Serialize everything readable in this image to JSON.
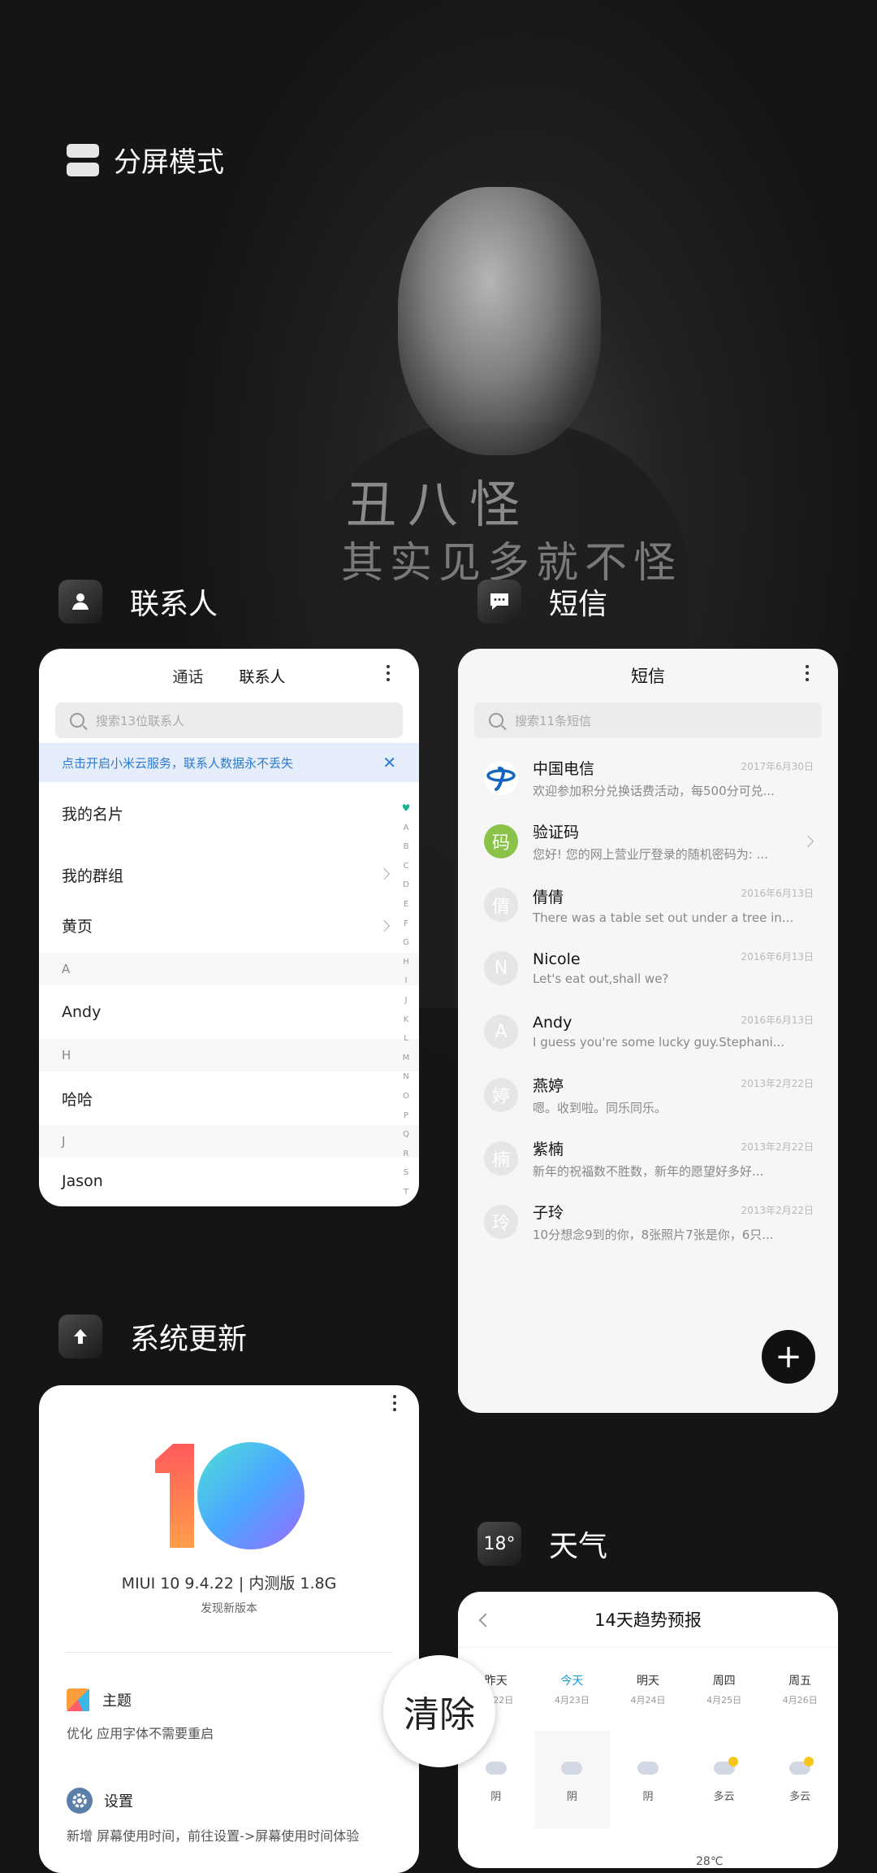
{
  "split_mode": {
    "label": "分屏模式"
  },
  "apps": {
    "contacts": {
      "name": "联系人",
      "tabs": [
        "通话",
        "联系人"
      ],
      "search_placeholder": "搜索13位联系人",
      "banner": "点击开启小米云服务，联系人数据永不丢失",
      "banner_close": "✕",
      "rows": {
        "my_card": "我的名片",
        "my_groups": "我的群组",
        "yellow_pages": "黄页"
      },
      "sections": [
        {
          "letter": "A",
          "contact": "Andy"
        },
        {
          "letter": "H",
          "contact": "哈哈"
        },
        {
          "letter": "J",
          "contact": "Jason"
        }
      ],
      "alphabet": [
        "A",
        "B",
        "C",
        "D",
        "E",
        "F",
        "G",
        "H",
        "I",
        "J",
        "K",
        "L",
        "M",
        "N",
        "O",
        "P",
        "Q",
        "R",
        "S",
        "T"
      ]
    },
    "sms": {
      "name": "短信",
      "title": "短信",
      "search_placeholder": "搜索11条短信",
      "messages": [
        {
          "avatar": "",
          "name": "中国电信",
          "preview": "欢迎参加积分兑换话费活动，每500分可兑...",
          "date": "2017年6月30日"
        },
        {
          "avatar": "码",
          "name": "验证码",
          "preview": "您好! 您的网上营业厅登录的随机密码为: ...",
          "date": ""
        },
        {
          "avatar": "倩",
          "name": "倩倩",
          "preview": "There was a table set out under a tree in...",
          "date": "2016年6月13日"
        },
        {
          "avatar": "N",
          "name": "Nicole",
          "preview": "Let's eat out,shall we?",
          "date": "2016年6月13日"
        },
        {
          "avatar": "A",
          "name": "Andy",
          "preview": "I guess you're some lucky guy.Stephani...",
          "date": "2016年6月13日"
        },
        {
          "avatar": "婷",
          "name": "燕婷",
          "preview": "嗯。收到啦。同乐同乐。",
          "date": "2013年2月22日"
        },
        {
          "avatar": "楠",
          "name": "紫楠",
          "preview": "新年的祝福数不胜数，新年的愿望好多好...",
          "date": "2013年2月22日"
        },
        {
          "avatar": "玲",
          "name": "子玲",
          "preview": "10分想念9到的你，8张照片7张是你，6只...",
          "date": "2013年2月22日"
        }
      ],
      "fab": "+"
    },
    "update": {
      "name": "系统更新",
      "version": "MIUI 10 9.4.22 | 内测版 1.8G",
      "status": "发现新版本",
      "items": [
        {
          "title": "主题",
          "desc": "优化 应用字体不需要重启"
        },
        {
          "title": "设置",
          "desc": "新增 屏幕使用时间，前往设置->屏幕使用时间体验"
        }
      ]
    },
    "weather": {
      "name": "天气",
      "icon_text": "18°",
      "title": "14天趋势预报",
      "days": [
        {
          "day": "昨天",
          "date": "4月22日",
          "cond": "阴"
        },
        {
          "day": "今天",
          "date": "4月23日",
          "cond": "阴"
        },
        {
          "day": "明天",
          "date": "4月24日",
          "cond": "阴"
        },
        {
          "day": "周四",
          "date": "4月25日",
          "cond": "多云"
        },
        {
          "day": "周五",
          "date": "4月26日",
          "cond": "多云"
        }
      ],
      "temp": "28℃"
    }
  },
  "clear_button": "清除",
  "wallpaper_text": {
    "line1": "丑八怪",
    "line2": "其实见多就不怪"
  },
  "colors": {
    "accent_blue": "#2e7ad1",
    "weather_today": "#1a9bd7",
    "verify_green": "#8bc34a",
    "telecom_blue": "#1565c0"
  }
}
